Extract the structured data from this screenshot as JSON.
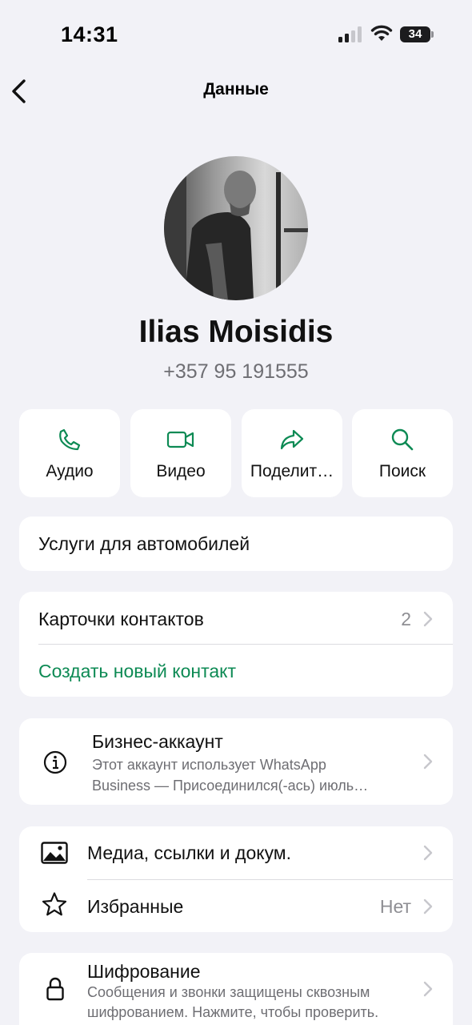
{
  "status_bar": {
    "time": "14:31",
    "battery": "34",
    "icons": [
      "signal-icon",
      "wifi-icon",
      "battery-icon"
    ]
  },
  "nav": {
    "title": "Данные",
    "back_icon": "chevron-left-icon"
  },
  "profile": {
    "name": "Ilias Moisidis",
    "phone": "+357 95 191555"
  },
  "actions": [
    {
      "label": "Аудио",
      "icon": "phone-icon"
    },
    {
      "label": "Видео",
      "icon": "video-icon"
    },
    {
      "label": "Поделит…",
      "icon": "share-icon"
    },
    {
      "label": "Поиск",
      "icon": "search-icon"
    }
  ],
  "category": "Услуги для автомобилей",
  "contacts": {
    "cards_label": "Карточки контактов",
    "cards_count": "2",
    "create_label": "Создать новый контакт"
  },
  "business": {
    "title": "Бизнес-аккаунт",
    "line1": "Этот аккаунт использует WhatsApp",
    "line2": "Business — Присоединился(-ась) июль…",
    "icon": "info-icon"
  },
  "media": {
    "media_label": "Медиа, ссылки и докум.",
    "starred_label": "Избранные",
    "starred_value": "Нет",
    "icons": [
      "image-icon",
      "star-icon"
    ]
  },
  "encryption": {
    "title": "Шифрование",
    "line1": "Сообщения и звонки защищены сквозным",
    "line2": "шифрованием. Нажмите, чтобы проверить.",
    "icon": "lock-icon"
  },
  "colors": {
    "accent": "#0d8a54",
    "background": "#f2f2f7",
    "card": "#ffffff",
    "secondary_text": "#6e6e73"
  }
}
